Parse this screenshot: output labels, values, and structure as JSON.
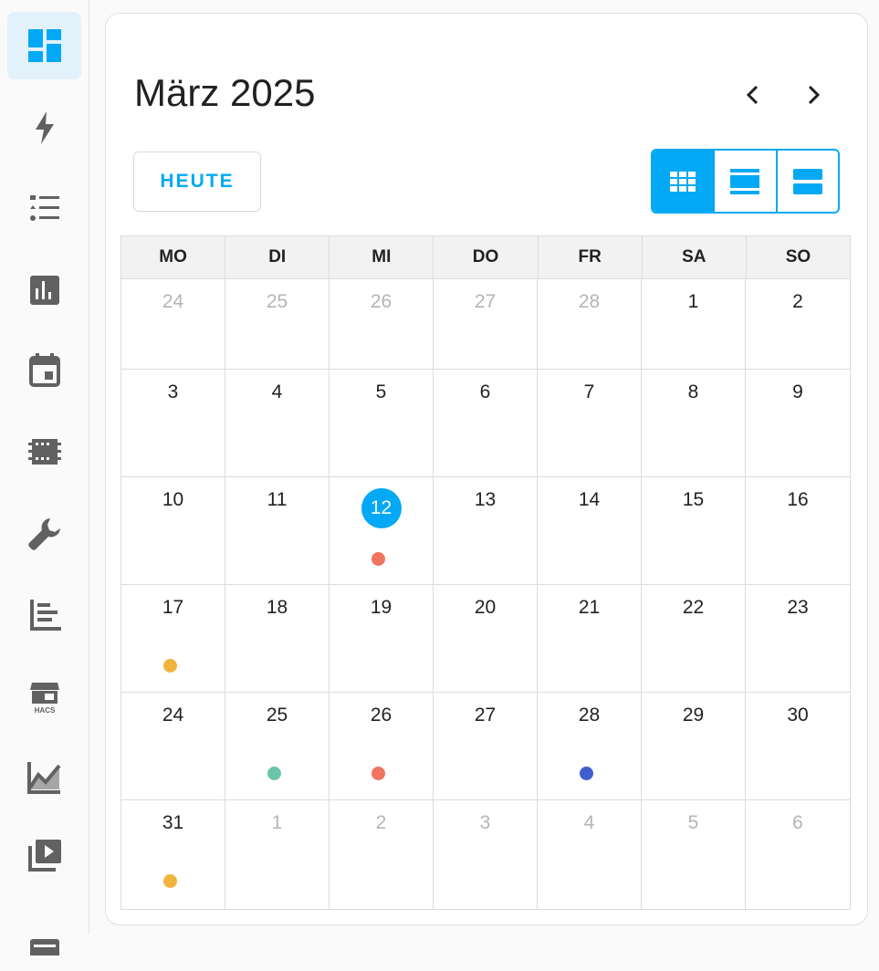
{
  "sidebar": {
    "items": [
      {
        "icon": "dashboard-icon",
        "active": true
      },
      {
        "icon": "energy-icon"
      },
      {
        "icon": "todo-list-icon"
      },
      {
        "icon": "history-icon"
      },
      {
        "icon": "calendar-icon"
      },
      {
        "icon": "chip-icon"
      },
      {
        "icon": "wrench-icon"
      },
      {
        "icon": "logbook-icon"
      },
      {
        "icon": "hacs-icon",
        "label": "HACS"
      },
      {
        "icon": "chart-line-icon"
      },
      {
        "icon": "media-icon"
      },
      {
        "icon": "terminal-icon"
      }
    ]
  },
  "header": {
    "title": "März 2025",
    "today_label": "HEUTE",
    "views": [
      {
        "name": "month-view-icon",
        "active": true
      },
      {
        "name": "week-view-icon",
        "active": false
      },
      {
        "name": "day-view-icon",
        "active": false
      }
    ]
  },
  "calendar": {
    "weekdays": [
      "MO",
      "DI",
      "MI",
      "DO",
      "FR",
      "SA",
      "SO"
    ],
    "weeks": [
      [
        {
          "d": "24",
          "other": true
        },
        {
          "d": "25",
          "other": true
        },
        {
          "d": "26",
          "other": true
        },
        {
          "d": "27",
          "other": true
        },
        {
          "d": "28",
          "other": true
        },
        {
          "d": "1"
        },
        {
          "d": "2"
        }
      ],
      [
        {
          "d": "3"
        },
        {
          "d": "4"
        },
        {
          "d": "5"
        },
        {
          "d": "6"
        },
        {
          "d": "7"
        },
        {
          "d": "8"
        },
        {
          "d": "9"
        }
      ],
      [
        {
          "d": "10"
        },
        {
          "d": "11"
        },
        {
          "d": "12",
          "today": true,
          "dot": "#f07560"
        },
        {
          "d": "13"
        },
        {
          "d": "14"
        },
        {
          "d": "15"
        },
        {
          "d": "16"
        }
      ],
      [
        {
          "d": "17",
          "dot": "#f0b43c"
        },
        {
          "d": "18"
        },
        {
          "d": "19"
        },
        {
          "d": "20"
        },
        {
          "d": "21"
        },
        {
          "d": "22"
        },
        {
          "d": "23"
        }
      ],
      [
        {
          "d": "24"
        },
        {
          "d": "25",
          "dot": "#6cc4aa"
        },
        {
          "d": "26",
          "dot": "#f07560"
        },
        {
          "d": "27"
        },
        {
          "d": "28",
          "dot": "#3f5fcf"
        },
        {
          "d": "29"
        },
        {
          "d": "30"
        }
      ],
      [
        {
          "d": "31",
          "dot": "#f0b43c"
        },
        {
          "d": "1",
          "other": true
        },
        {
          "d": "2",
          "other": true
        },
        {
          "d": "3",
          "other": true
        },
        {
          "d": "4",
          "other": true
        },
        {
          "d": "5",
          "other": true
        },
        {
          "d": "6",
          "other": true
        }
      ]
    ]
  },
  "colors": {
    "accent": "#03a9f4",
    "icon": "#616161"
  }
}
